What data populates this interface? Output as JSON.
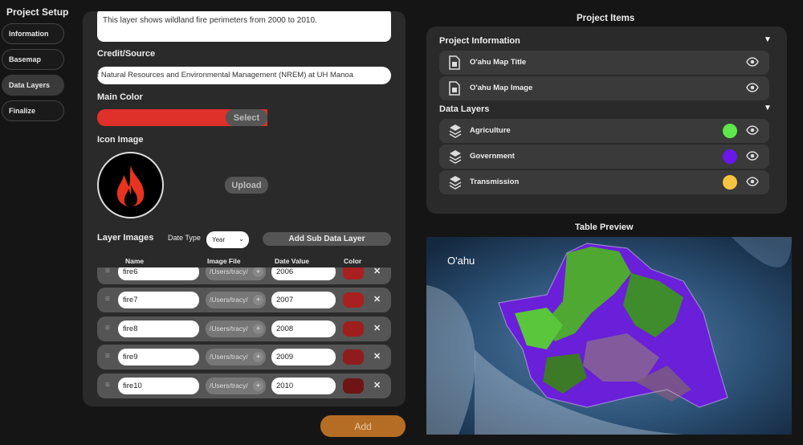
{
  "sidebar": {
    "title": "Project Setup",
    "items": [
      {
        "label": "Information"
      },
      {
        "label": "Basemap"
      },
      {
        "label": "Data Layers"
      },
      {
        "label": "Finalize"
      }
    ]
  },
  "form": {
    "description": "This layer shows wildland fire perimeters from 2000 to 2010.",
    "credit_label": "Credit/Source",
    "credit_value": "Department of Natural Resources and Environmental Management (NREM) at UH Manoa",
    "main_color_label": "Main Color",
    "main_color": "#e0302a",
    "select_label": "Select",
    "icon_image_label": "Icon Image",
    "icon": "fire-icon",
    "upload_label": "Upload",
    "layer_images_label": "Layer Images",
    "date_type_label": "Date Type",
    "date_type_value": "Year",
    "add_sub_label": "Add Sub Data Layer",
    "columns": [
      "Name",
      "Image File",
      "Date Value",
      "Color"
    ],
    "rows": [
      {
        "name": "fire6",
        "file": "/Users/tracy/",
        "date": "2006",
        "color": "#a82020"
      },
      {
        "name": "fire7",
        "file": "/Users/tracy/",
        "date": "2007",
        "color": "#a82020"
      },
      {
        "name": "fire8",
        "file": "/Users/tracy/",
        "date": "2008",
        "color": "#9e1e1e"
      },
      {
        "name": "fire9",
        "file": "/Users/tracy/",
        "date": "2009",
        "color": "#8f1c1c"
      },
      {
        "name": "fire10",
        "file": "/Users/tracy/",
        "date": "2010",
        "color": "#6e1414"
      }
    ],
    "add_label": "Add"
  },
  "project_items": {
    "title": "Project Items",
    "info_section": "Project Information",
    "info_items": [
      {
        "label": "O'ahu Map Title"
      },
      {
        "label": "O'ahu Map Image"
      }
    ],
    "layers_section": "Data Layers",
    "layers": [
      {
        "label": "Agriculture",
        "color": "#5ee84a"
      },
      {
        "label": "Government",
        "color": "#6a18e8"
      },
      {
        "label": "Transmission",
        "color": "#f5c542"
      }
    ]
  },
  "preview": {
    "title": "Table Preview",
    "map_label": "O'ahu"
  }
}
